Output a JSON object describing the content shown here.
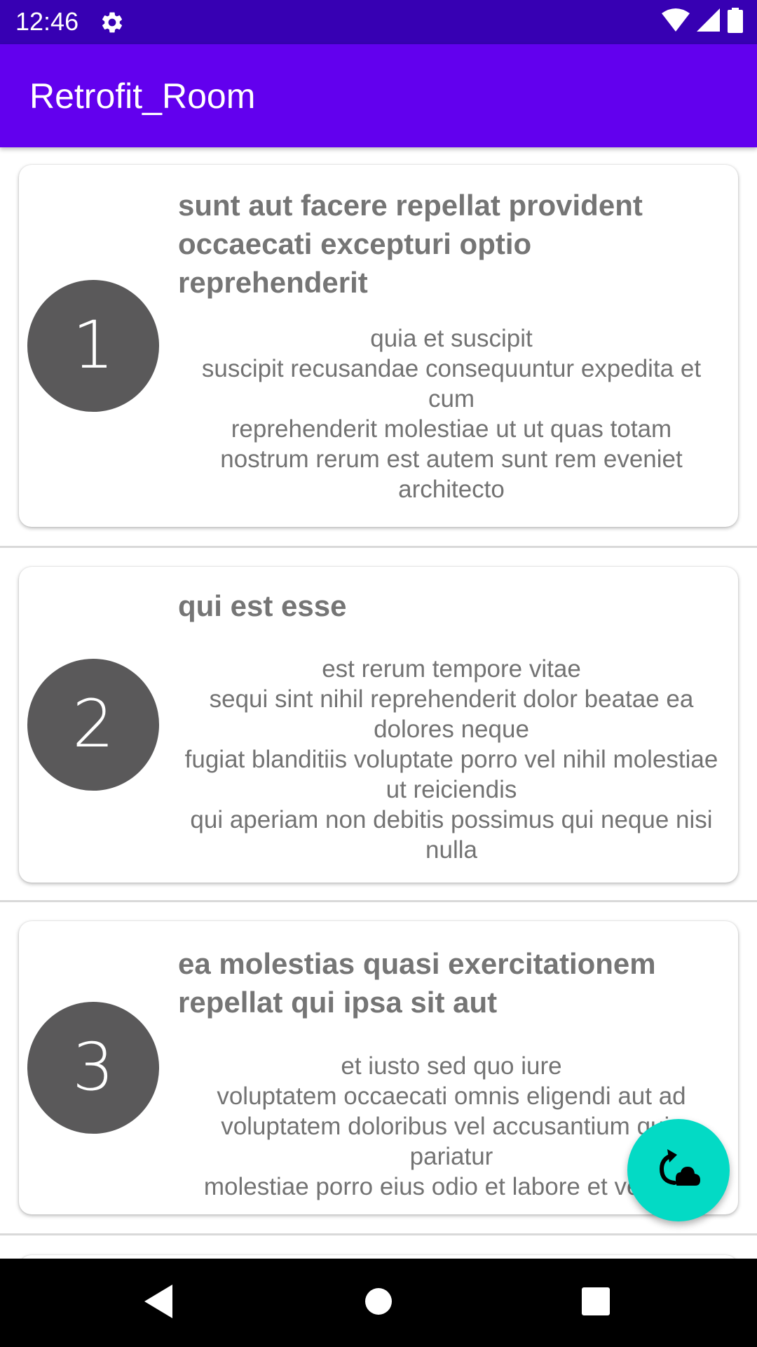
{
  "status_bar": {
    "time": "12:46",
    "icons": [
      "gear-icon",
      "wifi-icon",
      "signal-icon",
      "battery-icon"
    ]
  },
  "app_bar": {
    "title": "Retrofit_Room"
  },
  "posts": [
    {
      "id": "1",
      "title": "sunt aut facere repellat provident occaecati excepturi optio reprehenderit",
      "body": "quia et suscipit\nsuscipit recusandae consequuntur expedita et cum\nreprehenderit molestiae ut ut quas totam\nnostrum rerum est autem sunt rem eveniet architecto"
    },
    {
      "id": "2",
      "title": "qui est esse",
      "body": "est rerum tempore vitae\nsequi sint nihil reprehenderit dolor beatae ea dolores neque\nfugiat blanditiis voluptate porro vel nihil molestiae ut reiciendis\nqui aperiam non debitis possimus qui neque nisi nulla"
    },
    {
      "id": "3",
      "title": "ea molestias quasi exercitationem repellat qui ipsa sit aut",
      "body": "et iusto sed quo iure\nvoluptatem occaecati omnis eligendi aut ad\nvoluptatem doloribus vel accusantium quis pariatur\nmolestiae porro eius odio et labore et velit aut"
    }
  ],
  "fab": {
    "icon": "cloud-sync-icon"
  },
  "nav_bar": {
    "icons": [
      "back-icon",
      "home-icon",
      "recents-icon"
    ]
  },
  "colors": {
    "status_bar": "#3700b3",
    "app_bar": "#6200ee",
    "fab": "#03dac5",
    "avatar": "#5a595a",
    "text_gray": "#757575"
  }
}
